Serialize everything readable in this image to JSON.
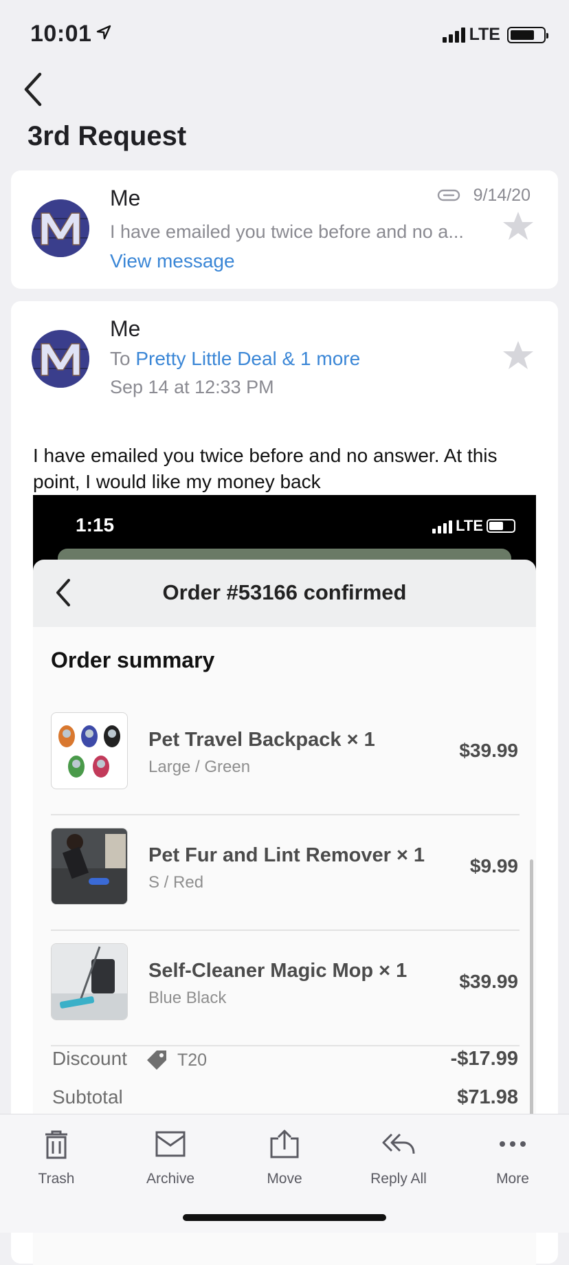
{
  "status_bar": {
    "time": "10:01",
    "network": "LTE"
  },
  "header": {
    "title": "3rd Request"
  },
  "thread": [
    {
      "sender": "Me",
      "date": "9/14/20",
      "preview": "I have emailed you twice before and no a...",
      "view_label": "View message"
    },
    {
      "sender": "Me",
      "to_prefix": "To",
      "recipients": "Pretty Little Deal & 1 more",
      "sent": "Sep 14 at 12:33 PM",
      "body": "I have emailed you twice before and no answer. At this point, I would like my money back"
    }
  ],
  "attachment": {
    "time": "1:15",
    "network": "LTE",
    "header_title": "Order #53166 confirmed",
    "summary_title": "Order summary",
    "items": [
      {
        "name": "Pet Travel Backpack × 1",
        "variant": "Large / Green",
        "price": "$39.99",
        "thumb": "backpacks-image"
      },
      {
        "name": "Pet Fur and Lint Remover × 1",
        "variant": "S / Red",
        "price": "$9.99",
        "thumb": "lint-remover-image"
      },
      {
        "name": "Self-Cleaner Magic Mop × 1",
        "variant": "Blue Black",
        "price": "$39.99",
        "thumb": "mop-image"
      }
    ],
    "discount": {
      "label": "Discount",
      "code": "T20",
      "amount": "-$17.99"
    },
    "subtotal": {
      "label": "Subtotal",
      "amount": "$71.98"
    }
  },
  "toolbar": [
    {
      "label": "Trash",
      "icon": "trash-icon"
    },
    {
      "label": "Archive",
      "icon": "archive-icon"
    },
    {
      "label": "Move",
      "icon": "move-icon"
    },
    {
      "label": "Reply All",
      "icon": "reply-all-icon"
    },
    {
      "label": "More",
      "icon": "more-icon"
    }
  ],
  "colors": {
    "link": "#3a86d6",
    "background": "#f0f0f3",
    "avatar": "#3a3e8c"
  }
}
